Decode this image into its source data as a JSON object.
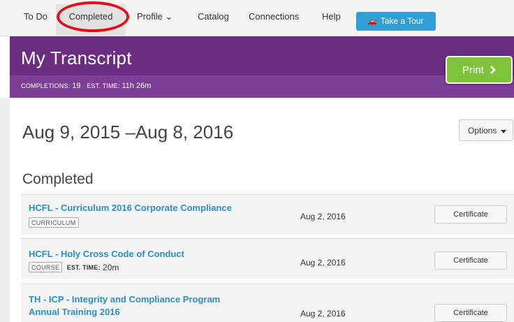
{
  "nav": {
    "items": [
      {
        "label": "To Do"
      },
      {
        "label": "Completed"
      },
      {
        "label": "Profile ⌄"
      },
      {
        "label": "Catalog"
      },
      {
        "label": "Connections"
      },
      {
        "label": "Help"
      }
    ],
    "tour_label": "Take a Tour",
    "tour_icon": "car-icon",
    "annotation_color": "#e10f17"
  },
  "header": {
    "title": "My Transcript",
    "completions_label": "COMPLETIONS:",
    "completions_value": "19",
    "est_time_label": "EST. TIME:",
    "est_time_value": "11h 26m",
    "print_label": "Print",
    "print_icon": "chevron-right-icon",
    "color": "#6b2d82",
    "print_color": "#7ec33a"
  },
  "main": {
    "date_range": "Aug 9, 2015 –Aug 8, 2016",
    "options_label": "Options",
    "section_title": "Completed",
    "link_color": "#2a8fc4",
    "records": [
      {
        "name_line1": "HCFL - Curriculum 2016 Corporate Compliance",
        "name_line2": "",
        "type": "CURRICULUM",
        "est_label": "",
        "est_value": "",
        "date": "Aug 2, 2016",
        "button": "Certificate"
      },
      {
        "name_line1": "HCFL - Holy Cross Code of Conduct",
        "name_line2": "",
        "type": "COURSE",
        "est_label": "EST. TIME:",
        "est_value": "20m",
        "date": "Aug 2, 2016",
        "button": "Certificate"
      },
      {
        "name_line1": "TH - ICP - Integrity and Compliance Program",
        "name_line2": "Annual Training 2016",
        "type": "",
        "est_label": "",
        "est_value": "",
        "date": "Aug 2, 2016",
        "button": "Certificate"
      }
    ]
  }
}
